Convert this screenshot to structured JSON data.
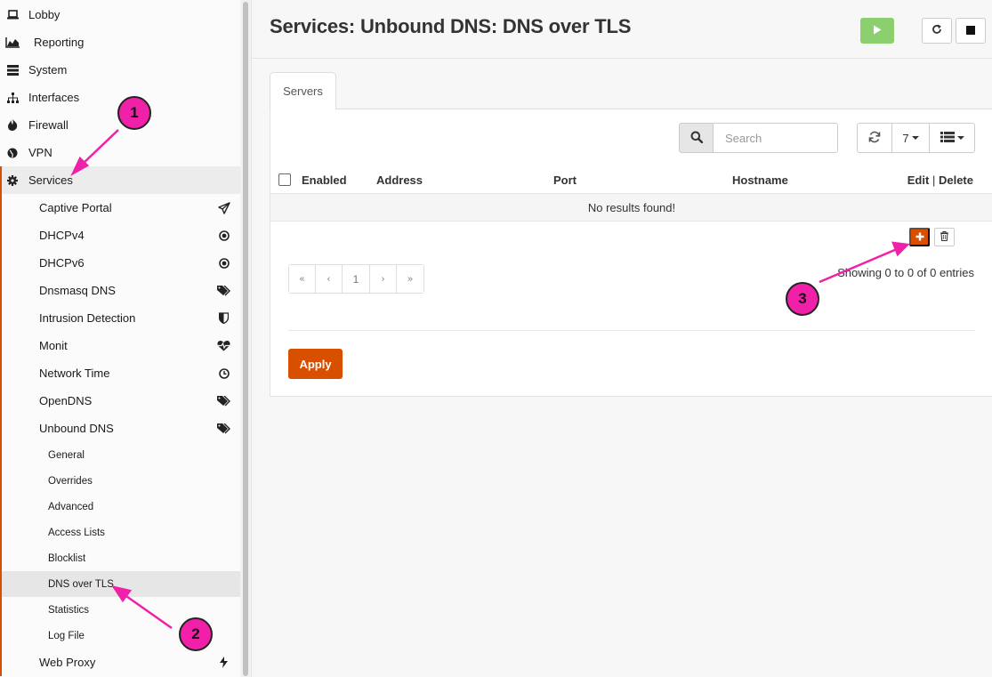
{
  "sidebar": {
    "top_items": [
      {
        "label": "Lobby",
        "icon": "laptop-icon"
      },
      {
        "label": "Reporting",
        "icon": "area-chart-icon"
      },
      {
        "label": "System",
        "icon": "server-icon"
      },
      {
        "label": "Interfaces",
        "icon": "sitemap-icon"
      },
      {
        "label": "Firewall",
        "icon": "fire-icon"
      },
      {
        "label": "VPN",
        "icon": "globe-icon"
      },
      {
        "label": "Services",
        "icon": "gear-icon"
      }
    ],
    "services_items": [
      {
        "label": "Captive Portal",
        "icon": "paper-plane-icon"
      },
      {
        "label": "DHCPv4",
        "icon": "bullseye-icon"
      },
      {
        "label": "DHCPv6",
        "icon": "bullseye-icon"
      },
      {
        "label": "Dnsmasq DNS",
        "icon": "tags-icon"
      },
      {
        "label": "Intrusion Detection",
        "icon": "shield-icon"
      },
      {
        "label": "Monit",
        "icon": "heartbeat-icon"
      },
      {
        "label": "Network Time",
        "icon": "clock-icon"
      },
      {
        "label": "OpenDNS",
        "icon": "tags-icon"
      },
      {
        "label": "Unbound DNS",
        "icon": "tags-icon"
      }
    ],
    "unbound_items": [
      "General",
      "Overrides",
      "Advanced",
      "Access Lists",
      "Blocklist",
      "DNS over TLS",
      "Statistics",
      "Log File"
    ],
    "web_proxy": {
      "label": "Web Proxy",
      "icon": "bolt-icon"
    }
  },
  "header": {
    "title": "Services: Unbound DNS: DNS over TLS"
  },
  "tabs": [
    {
      "label": "Servers"
    }
  ],
  "grid": {
    "search_placeholder": "Search",
    "rows_per_page": "7",
    "columns": [
      "Enabled",
      "Address",
      "Port",
      "Hostname"
    ],
    "edit_label": "Edit",
    "separator": "|",
    "delete_label": "Delete",
    "empty_message": "No results found!",
    "pager": [
      "«",
      "‹",
      "1",
      "›",
      "»"
    ],
    "showing": "Showing 0 to 0 of 0 entries"
  },
  "apply_label": "Apply",
  "annotations": [
    "1",
    "2",
    "3"
  ],
  "colors": {
    "accent": "#d94f00",
    "start": "#8ccf6f",
    "annotation": "#f020a8"
  }
}
